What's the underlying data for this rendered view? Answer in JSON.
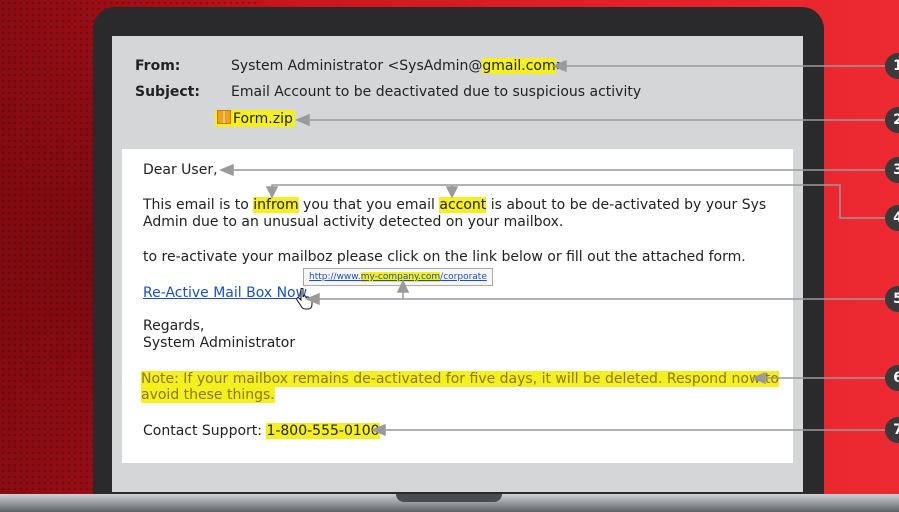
{
  "email": {
    "from_label": "From:",
    "from_name": "System Administrator <SysAdmin@",
    "from_domain": "gmail.com",
    "from_close": ">",
    "subject_label": "Subject:",
    "subject": "Email Account to be deactivated due to suspicious activity",
    "attachment": "Form.zip"
  },
  "body": {
    "greeting": "Dear User,",
    "p1_a": "This email is to ",
    "p1_typo1": "infrom",
    "p1_b": " you that you email ",
    "p1_typo2": "accont",
    "p1_c": " is about to be de-activated by your Sys",
    "p1_line2": "Admin due to an unusual activity detected on your mailbox.",
    "p2": "to re-activate your mailboz please click on the link below or fill out the attached form.",
    "link_text": "Re-Active Mail Box Now",
    "tooltip_prefix": "http://www.",
    "tooltip_domain": "my-company.com",
    "tooltip_suffix": "/corporate",
    "regards": "Regards,",
    "signature": "System Administrator",
    "note_line1": "Note: If your mailbox remains de-activated for five days, it will be deleted. Respond now to",
    "note_line2": "avoid these things.",
    "contact_label": "Contact Support: ",
    "contact_phone": "1-800-555-0100"
  },
  "callouts": [
    "1",
    "2",
    "3",
    "4",
    "5",
    "6",
    "7"
  ],
  "colors": {
    "highlight": "#f6ef1f",
    "link": "#1a4fcf",
    "background": "#c8141c"
  }
}
